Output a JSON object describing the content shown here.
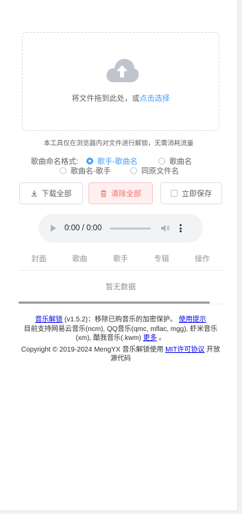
{
  "drop_zone": {
    "hint_prefix": "将文件拖到此处，或",
    "hint_link": "点击选择"
  },
  "notice": "本工具仅在浏览器内对文件进行解锁，无需消耗流量",
  "naming": {
    "label": "歌曲命名格式:",
    "options": [
      {
        "label": "歌手-歌曲名",
        "checked": true
      },
      {
        "label": "歌曲名",
        "checked": false
      },
      {
        "label": "歌曲名-歌手",
        "checked": false
      },
      {
        "label": "同原文件名",
        "checked": false
      }
    ]
  },
  "actions": {
    "download_all": "下载全部",
    "clear_all": "清除全部",
    "save_immediately": "立即保存"
  },
  "player": {
    "time": "0:00 / 0:00"
  },
  "table": {
    "columns": [
      "封面",
      "歌曲",
      "歌手",
      "专辑",
      "操作"
    ],
    "empty_text": "暂无数据"
  },
  "footer": {
    "line1": {
      "app_link": "音乐解锁",
      "version_text": "(v1.5.2)：移除已购音乐的加密保护。",
      "help_link": "使用提示"
    },
    "line2": {
      "text": "目前支持网易云音乐(ncm), QQ音乐(qmc, mflac, mgg), 虾米音乐(xm), 酷我音乐(.kwm)",
      "more_link": "更多",
      "suffix": "。"
    },
    "line3": {
      "text": "Copyright © 2019-2024 MengYX 音乐解锁使用",
      "license_link": "MIT许可协议",
      "suffix": "开放源代码"
    }
  },
  "colors": {
    "primary": "#409eff",
    "danger": "#f56c6c",
    "danger_bg": "#fef0f0",
    "icon_gray": "#c0c4cc"
  }
}
